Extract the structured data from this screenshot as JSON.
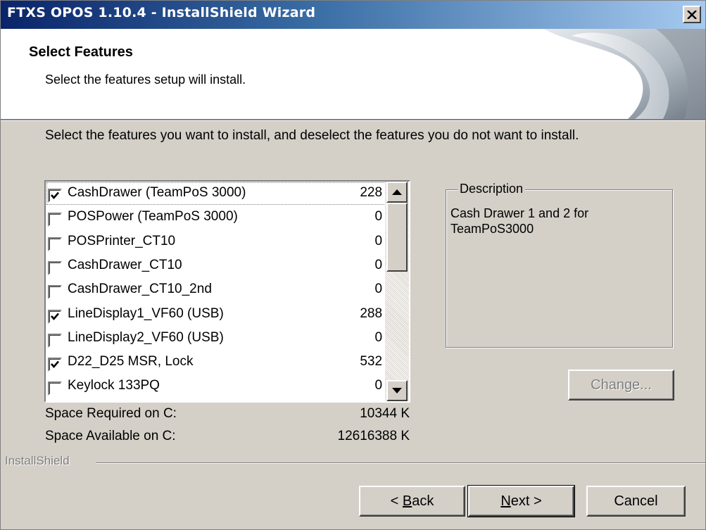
{
  "window": {
    "title": "FTXS OPOS 1.10.4 - InstallShield Wizard"
  },
  "header": {
    "title": "Select Features",
    "subtitle": "Select the features setup will install."
  },
  "instruction": "Select the features you want to install, and deselect the features you do not want to install.",
  "features": [
    {
      "name": "CashDrawer (TeamPoS 3000)",
      "size": "228 K",
      "checked": true
    },
    {
      "name": "POSPower (TeamPoS 3000)",
      "size": "0 K",
      "checked": false
    },
    {
      "name": "POSPrinter_CT10",
      "size": "0 K",
      "checked": false
    },
    {
      "name": "CashDrawer_CT10",
      "size": "0 K",
      "checked": false
    },
    {
      "name": "CashDrawer_CT10_2nd",
      "size": "0 K",
      "checked": false
    },
    {
      "name": "LineDisplay1_VF60 (USB)",
      "size": "288 K",
      "checked": true
    },
    {
      "name": "LineDisplay2_VF60 (USB)",
      "size": "0 K",
      "checked": false
    },
    {
      "name": "D22_D25 MSR, Lock",
      "size": "532 K",
      "checked": true
    },
    {
      "name": "Keylock 133PQ",
      "size": "0 K",
      "checked": false
    }
  ],
  "description": {
    "legend": "Description",
    "text": "Cash Drawer 1 and 2 for TeamPoS3000"
  },
  "space": {
    "required_label": "Space Required on  C:",
    "required_value": "10344 K",
    "available_label": "Space Available on  C:",
    "available_value": "12616388 K"
  },
  "buttons": {
    "change": "Change...",
    "back_prefix": "< ",
    "back_mnemonic": "B",
    "back_rest": "ack",
    "next_mnemonic": "N",
    "next_rest": "ext >",
    "cancel": "Cancel"
  },
  "footer": {
    "brand": "InstallShield"
  }
}
